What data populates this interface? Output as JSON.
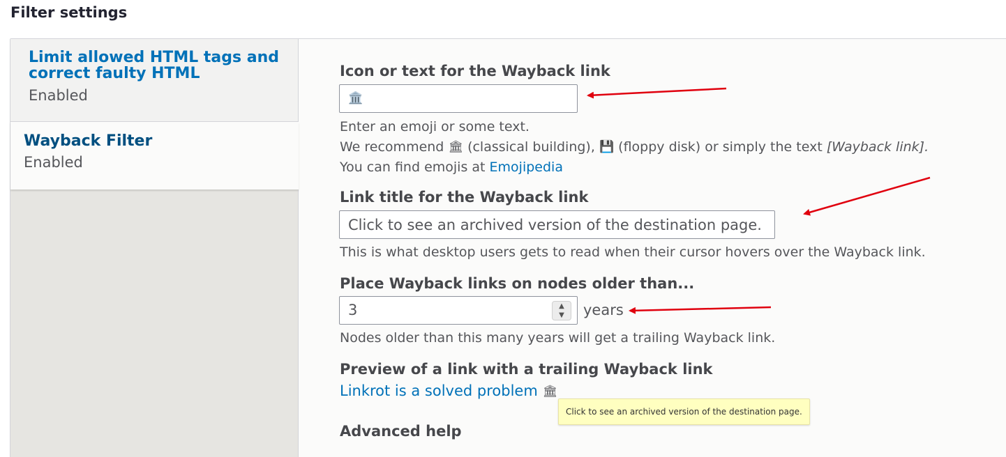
{
  "page": {
    "title": "Filter settings"
  },
  "vertical_tabs": [
    {
      "title": "Limit allowed HTML tags and correct faulty HTML",
      "summary": "Enabled"
    },
    {
      "title": "Wayback Filter",
      "summary": "Enabled"
    }
  ],
  "fields": {
    "icon_label": "Icon or text for the Wayback link",
    "icon_value": "🏛️",
    "icon_desc_1": "Enter an emoji or some text.",
    "icon_desc_2_prefix": "We recommend",
    "icon_desc_2_building_emoji": "🏛",
    "icon_desc_2_building": "(classical building),",
    "icon_desc_2_floppy_emoji": "💾",
    "icon_desc_2_floppy": "(floppy disk) or simply the text",
    "icon_desc_2_text": "[Wayback link].",
    "icon_desc_3_prefix": "You can find emojis at",
    "icon_desc_3_link": "Emojipedia",
    "title_label": "Link title for the Wayback link",
    "title_value": "Click to see an archived version of the destination page.",
    "title_desc": "This is what desktop users gets to read when their cursor hovers over the Wayback link.",
    "years_label": "Place Wayback links on nodes older than...",
    "years_value": "3",
    "years_suffix": "years",
    "years_desc": "Nodes older than this many years will get a trailing Wayback link.",
    "preview_label": "Preview of a link with a trailing Wayback link",
    "preview_link": "Linkrot is a solved problem",
    "preview_icon": "🏛",
    "tooltip": "Click to see an archived version of the destination page.",
    "advanced_label": "Advanced help"
  },
  "icons": {
    "spin_up": "▲",
    "spin_down": "▼"
  },
  "colors": {
    "link": "#0071b8",
    "active_tab_title": "#004f80",
    "annotation_arrow": "#e0000e",
    "tooltip_bg": "#ffffc0"
  }
}
